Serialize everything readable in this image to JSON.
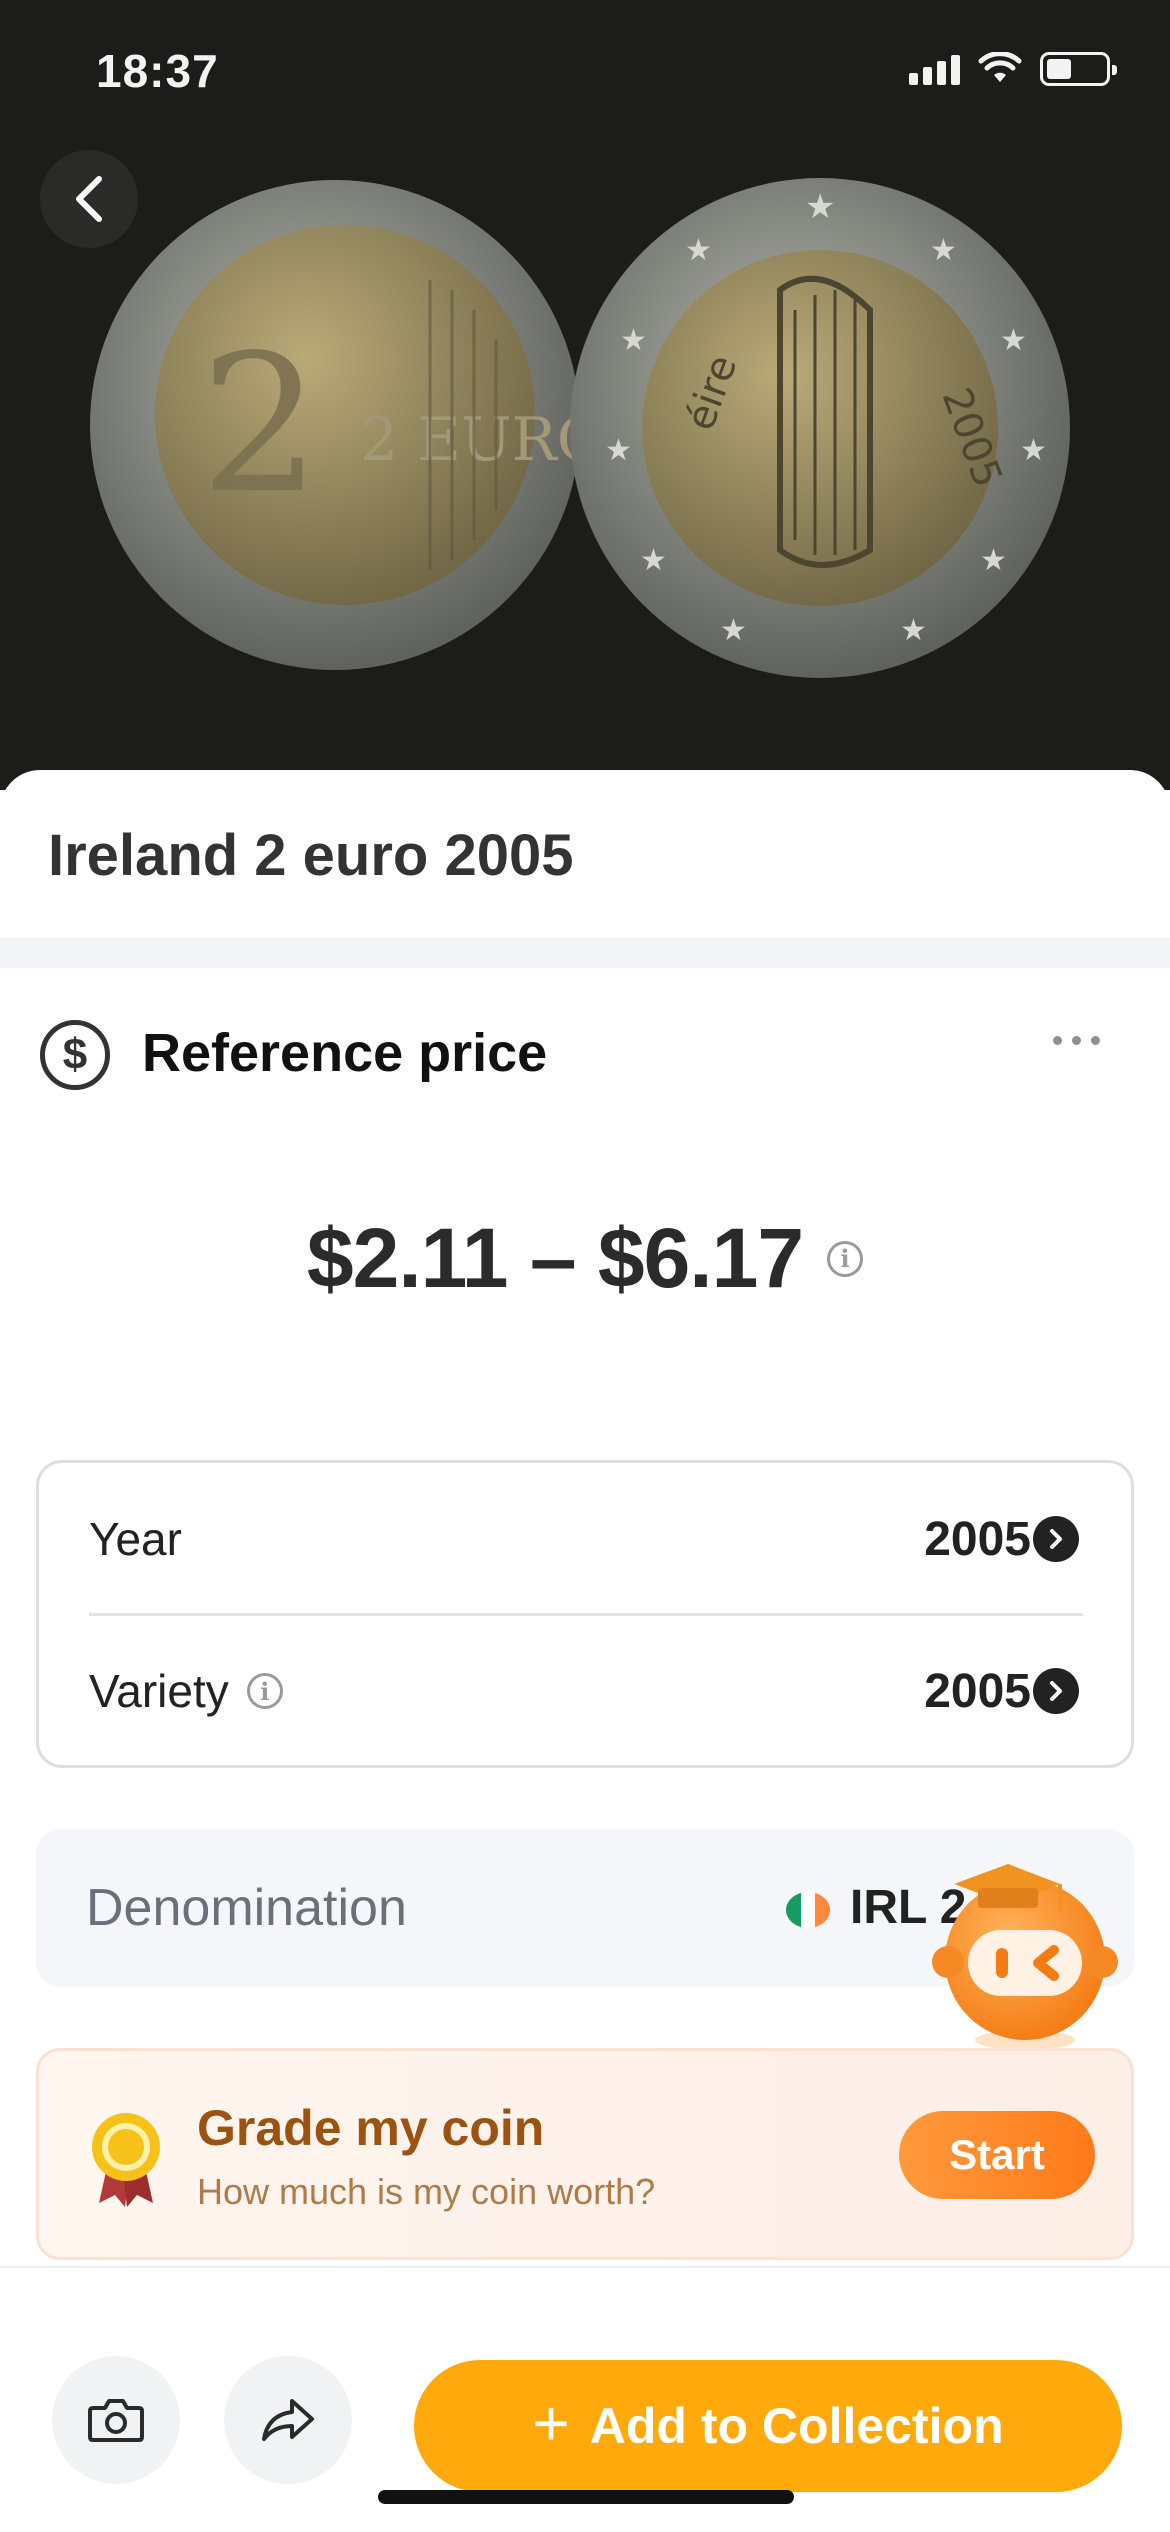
{
  "status_bar": {
    "time": "18:37"
  },
  "hero": {
    "coin_front_text": "2 EURO",
    "coin_back_text": "éire",
    "coin_back_year": "2005"
  },
  "coin": {
    "title": "Ireland 2 euro 2005"
  },
  "reference_price": {
    "heading": "Reference price",
    "price_range": "$2.11 – $6.17"
  },
  "details": [
    {
      "label": "Year",
      "value": "2005"
    },
    {
      "label": "Variety",
      "value": "2005"
    }
  ],
  "denomination": {
    "label": "Denomination",
    "value": "IRL 2"
  },
  "grade": {
    "title": "Grade my coin",
    "subtitle": "How much is my coin worth?",
    "button": "Start"
  },
  "bottom_bar": {
    "add_label": "Add to Collection"
  },
  "colors": {
    "accent": "#ffa90c",
    "grade_button": "#ff7a1a",
    "flag_green": "#169b62",
    "flag_orange": "#ff883e"
  },
  "icons": [
    "back-arrow-icon",
    "dollar-circle-icon",
    "more-icon",
    "info-icon",
    "chevron-right-icon",
    "camera-icon",
    "share-icon",
    "plus-icon",
    "medal-icon"
  ]
}
